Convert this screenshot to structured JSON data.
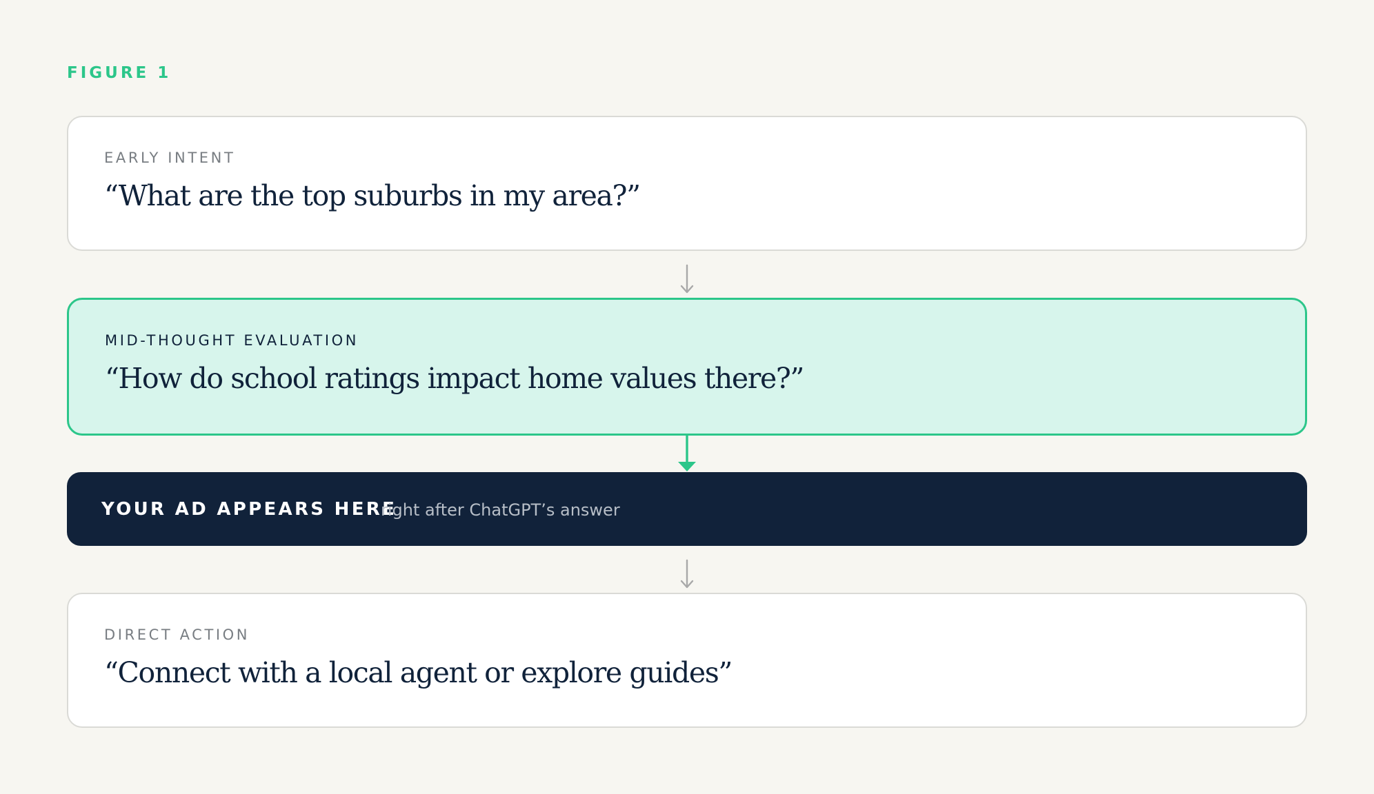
{
  "figure_label": "FIGURE 1",
  "colors": {
    "accent": "#2cc68a",
    "dark": "#11223a",
    "highlight_fill": "#d7f5ec",
    "background": "#f7f6f1",
    "arrow_gray": "#a8a8a8"
  },
  "steps": [
    {
      "eyebrow": "EARLY INTENT",
      "quote": "“What are the top suburbs in my area?”"
    },
    {
      "eyebrow": "MID-THOUGHT EVALUATION",
      "quote": "“How do school ratings impact home values there?”"
    },
    {
      "eyebrow": "DIRECT ACTION",
      "quote": "“Connect with a local agent or explore guides”"
    }
  ],
  "ad_slot": {
    "title": "YOUR AD APPEARS HERE",
    "subtitle": "right after ChatGPT’s answer"
  },
  "icons": {
    "flow_arrow": "arrow-down-icon"
  }
}
